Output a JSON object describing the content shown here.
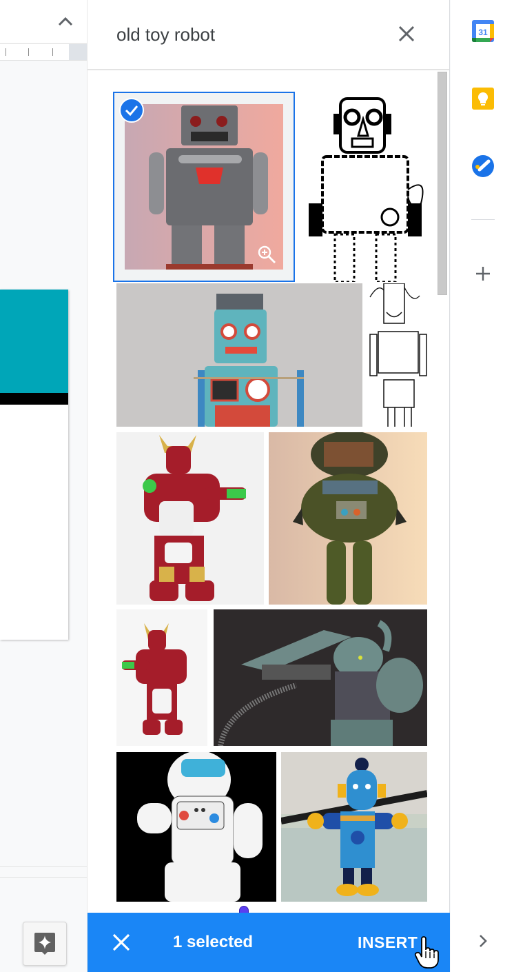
{
  "search": {
    "query": "old toy robot",
    "close_icon": "close-icon"
  },
  "results": {
    "images": [
      {
        "id": "robot-silver-tin",
        "description": "Grey tin toy robot on pink background",
        "selected": true
      },
      {
        "id": "robot-line-drawing-1",
        "description": "Black and white line drawing of tin robot",
        "selected": false
      },
      {
        "id": "robot-teal-tin",
        "description": "Teal tin toy robot with gauges",
        "selected": false
      },
      {
        "id": "robot-sketch",
        "description": "Sketched rectangular robot",
        "selected": false
      },
      {
        "id": "robot-red-action-1",
        "description": "Red and gold toy robot with blaster",
        "selected": false
      },
      {
        "id": "robot-green-classic",
        "description": "Green classic robot toy on peach background",
        "selected": false
      },
      {
        "id": "robot-red-action-2",
        "description": "Smaller red and gold toy robot",
        "selected": false
      },
      {
        "id": "robot-gundam-model",
        "description": "Green mech model with cannon",
        "selected": false
      },
      {
        "id": "robot-astronaut-drawing",
        "description": "White robot drawing on black background",
        "selected": false
      },
      {
        "id": "robot-wooden-blue",
        "description": "Blue wooden toy robot with yellow feet",
        "selected": false
      }
    ]
  },
  "selection_bar": {
    "count_label": "1 selected",
    "insert_label": "INSERT",
    "cancel_icon": "close-icon"
  },
  "side_panel": {
    "apps": [
      {
        "name": "Calendar",
        "icon": "calendar-icon",
        "day": "31"
      },
      {
        "name": "Keep",
        "icon": "keep-icon"
      },
      {
        "name": "Tasks",
        "icon": "tasks-icon"
      }
    ],
    "add_label": "Get add-ons",
    "expand_label": "Show side panel"
  },
  "colors": {
    "accent": "#1a73e8",
    "action_bar": "#1a86f6",
    "slide_banner": "#00a6b8",
    "keep_yellow": "#fbbc04"
  }
}
